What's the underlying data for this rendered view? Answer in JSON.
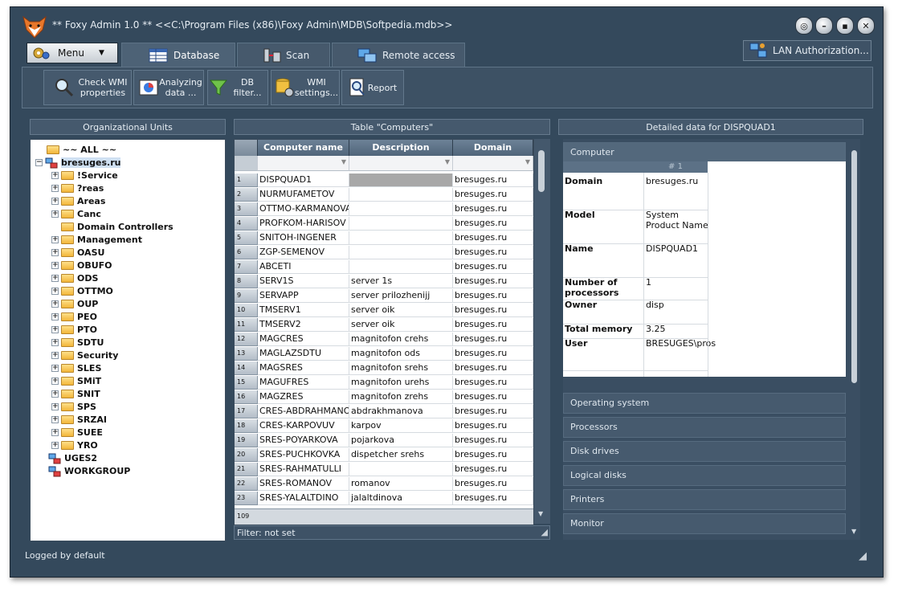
{
  "window": {
    "title": "** Foxy Admin 1.0 ** <<C:\\Program Files (x86)\\Foxy Admin\\MDB\\Softpedia.mdb>>",
    "status": "Logged by default"
  },
  "top": {
    "menu_label": "Menu",
    "tabs": [
      {
        "label": "Database"
      },
      {
        "label": "Scan"
      },
      {
        "label": "Remote access"
      }
    ],
    "lan_label": "LAN Authorization..."
  },
  "toolbar": {
    "check_wmi": "Check WMI properties",
    "analyzing": "Analyzing data ...",
    "db_filter": "DB filter...",
    "wmi_settings": "WMI settings...",
    "report": "Report"
  },
  "org_units": {
    "title": "Organizational Units",
    "all": "~~ ALL ~~",
    "domain": "bresuges.ru",
    "children": [
      "!Service",
      "?reas",
      "Areas",
      "Canc",
      "Domain Controllers",
      "Management",
      "OASU",
      "OBUFO",
      "ODS",
      "OTTMO",
      "OUP",
      "PEO",
      "PTO",
      "SDTU",
      "Security",
      "SLES",
      "SMiT",
      "SNIT",
      "SPS",
      "SRZAI",
      "SUEE",
      "YRO"
    ],
    "others": [
      "UGES2",
      "WORKGROUP"
    ]
  },
  "computers_table": {
    "title": "Table \"Computers\"",
    "columns": [
      "Computer name",
      "Description",
      "Domain"
    ],
    "rows": [
      {
        "n": "1",
        "name": "DISPQUAD1",
        "desc": "",
        "domain": "bresuges.ru"
      },
      {
        "n": "2",
        "name": "NURMUFAMETOV",
        "desc": "",
        "domain": "bresuges.ru"
      },
      {
        "n": "3",
        "name": "OTTMO-KARMANOVA",
        "desc": "",
        "domain": "bresuges.ru"
      },
      {
        "n": "4",
        "name": "PROFKOM-HARISOV",
        "desc": "",
        "domain": "bresuges.ru"
      },
      {
        "n": "5",
        "name": "SNITOH-INGENER",
        "desc": "",
        "domain": "bresuges.ru"
      },
      {
        "n": "6",
        "name": "ZGP-SEMENOV",
        "desc": "",
        "domain": "bresuges.ru"
      },
      {
        "n": "7",
        "name": "ABCETI",
        "desc": "",
        "domain": "bresuges.ru"
      },
      {
        "n": "8",
        "name": "SERV1S",
        "desc": "server 1s",
        "domain": "bresuges.ru"
      },
      {
        "n": "9",
        "name": "SERVAPP",
        "desc": "server prilozhenijj",
        "domain": "bresuges.ru"
      },
      {
        "n": "10",
        "name": "TMSERV1",
        "desc": "server oik",
        "domain": "bresuges.ru"
      },
      {
        "n": "11",
        "name": "TMSERV2",
        "desc": "server oik",
        "domain": "bresuges.ru"
      },
      {
        "n": "12",
        "name": "MAGCRES",
        "desc": "magnitofon crehs",
        "domain": "bresuges.ru"
      },
      {
        "n": "13",
        "name": "MAGLAZSDTU",
        "desc": "magnitofon ods",
        "domain": "bresuges.ru"
      },
      {
        "n": "14",
        "name": "MAGSRES",
        "desc": "magnitofon srehs",
        "domain": "bresuges.ru"
      },
      {
        "n": "15",
        "name": "MAGUFRES",
        "desc": "magnitofon urehs",
        "domain": "bresuges.ru"
      },
      {
        "n": "16",
        "name": "MAGZRES",
        "desc": "magnitofon zrehs",
        "domain": "bresuges.ru"
      },
      {
        "n": "17",
        "name": "CRES-ABDRAHMANO",
        "desc": "abdrakhmanova",
        "domain": "bresuges.ru"
      },
      {
        "n": "18",
        "name": "CRES-KARPOVUV",
        "desc": "karpov",
        "domain": "bresuges.ru"
      },
      {
        "n": "19",
        "name": "SRES-POYARKOVA",
        "desc": "pojarkova",
        "domain": "bresuges.ru"
      },
      {
        "n": "20",
        "name": "SRES-PUCHKOVKA",
        "desc": "dispetcher srehs",
        "domain": "bresuges.ru"
      },
      {
        "n": "21",
        "name": "SRES-RAHMATULLI",
        "desc": "",
        "domain": "bresuges.ru"
      },
      {
        "n": "22",
        "name": "SRES-ROMANOV",
        "desc": "romanov",
        "domain": "bresuges.ru"
      },
      {
        "n": "23",
        "name": "SRES-YALALTDINO",
        "desc": "jalaltdinova",
        "domain": "bresuges.ru"
      }
    ],
    "total": "109",
    "filter": "Filter: not set"
  },
  "detail": {
    "title": "Detailed data for DISPQUAD1",
    "open_section": "Computer",
    "col_header": "# 1",
    "fields": [
      {
        "label": "Domain",
        "value": "bresuges.ru"
      },
      {
        "label": "Model",
        "value": "System Product Name"
      },
      {
        "label": "Name",
        "value": "DISPQUAD1"
      },
      {
        "label": "Number of processors",
        "value": "1"
      },
      {
        "label": "Owner",
        "value": "disp"
      },
      {
        "label": "Total memory",
        "value": "3.25"
      },
      {
        "label": "User",
        "value": "BRESUGES\\pros"
      }
    ],
    "sections": [
      "Operating system",
      "Processors",
      "Disk drives",
      "Logical disks",
      "Printers",
      "Monitor"
    ]
  },
  "colors": {
    "window_bg": "#34495c",
    "header_blue": "#5a6f84",
    "selected_row": "#a8a8a8"
  }
}
